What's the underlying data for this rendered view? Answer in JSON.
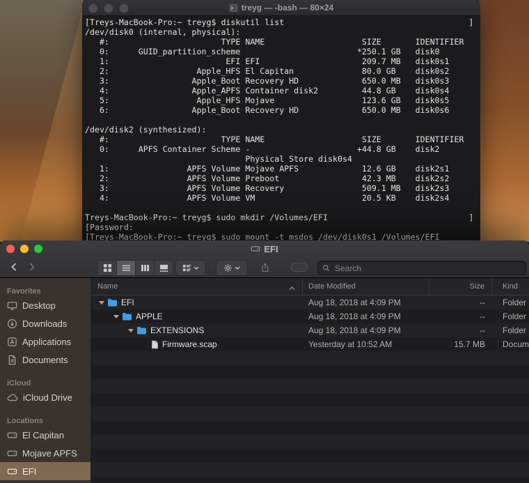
{
  "terminal": {
    "title": "treyg — -bash — 80×24",
    "lines": [
      "[Treys-MacBook-Pro:~ treyg$ diskutil list                                      ]",
      "/dev/disk0 (internal, physical):",
      "   #:                       TYPE NAME                    SIZE       IDENTIFIER",
      "   0:      GUID_partition_scheme                        *250.1 GB   disk0",
      "   1:                        EFI EFI                     209.7 MB   disk0s1",
      "   2:                  Apple_HFS El Capitan              80.0 GB    disk0s2",
      "   3:                 Apple_Boot Recovery HD             650.0 MB   disk0s3",
      "   4:                 Apple_APFS Container disk2         44.8 GB    disk0s4",
      "   5:                  Apple_HFS Mojave                  123.6 GB   disk0s5",
      "   6:                 Apple_Boot Recovery HD             650.0 MB   disk0s6",
      "",
      "/dev/disk2 (synthesized):",
      "   #:                       TYPE NAME                    SIZE       IDENTIFIER",
      "   0:      APFS Container Scheme -                      +44.8 GB    disk2",
      "                                 Physical Store disk0s4",
      "   1:                APFS Volume Mojave APFS             12.6 GB    disk2s1",
      "   2:                APFS Volume Preboot                 42.3 MB    disk2s2",
      "   3:                APFS Volume Recovery                509.1 MB   disk2s3",
      "   4:                APFS Volume VM                      20.5 KB    disk2s4",
      "",
      "Treys-MacBook-Pro:~ treyg$ sudo mkdir /Volumes/EFI                             ]",
      "[Password:",
      "[Treys-MacBook-Pro:~ treyg$ sudo mount -t msdos /dev/disk0s1 /Volumes/EFI"
    ]
  },
  "finder": {
    "title": "EFI",
    "toolbar": {
      "search_placeholder": "Search",
      "view_modes": [
        "icon-view",
        "list-view",
        "column-view",
        "gallery-view"
      ],
      "selected_view": "list-view"
    },
    "sidebar": {
      "sections": [
        {
          "label": "Favorites",
          "items": [
            {
              "label": "Desktop",
              "icon": "desktop-icon"
            },
            {
              "label": "Downloads",
              "icon": "downloads-icon"
            },
            {
              "label": "Applications",
              "icon": "applications-icon"
            },
            {
              "label": "Documents",
              "icon": "documents-icon"
            }
          ]
        },
        {
          "label": "iCloud",
          "items": [
            {
              "label": "iCloud Drive",
              "icon": "cloud-icon"
            }
          ]
        },
        {
          "label": "Locations",
          "items": [
            {
              "label": "El Capitan",
              "icon": "disk-icon"
            },
            {
              "label": "Mojave APFS",
              "icon": "disk-icon"
            },
            {
              "label": "EFI",
              "icon": "disk-icon",
              "selected": true
            }
          ]
        }
      ]
    },
    "list": {
      "columns": [
        "Name",
        "Date Modified",
        "Size",
        "Kind"
      ],
      "sort_column": "Name",
      "sort_direction": "ascending",
      "rows": [
        {
          "name": "EFI",
          "date": "Aug 18, 2018 at 4:09 PM",
          "size": "--",
          "kind": "Folder",
          "icon": "folder-icon",
          "indent": 0,
          "expanded": true
        },
        {
          "name": "APPLE",
          "date": "Aug 18, 2018 at 4:09 PM",
          "size": "--",
          "kind": "Folder",
          "icon": "folder-icon",
          "indent": 1,
          "expanded": true
        },
        {
          "name": "EXTENSIONS",
          "date": "Aug 18, 2018 at 4:09 PM",
          "size": "--",
          "kind": "Folder",
          "icon": "folder-icon",
          "indent": 2,
          "expanded": true
        },
        {
          "name": "Firmware.scap",
          "date": "Yesterday at 10:52 AM",
          "size": "15.7 MB",
          "kind": "Document",
          "icon": "document-icon",
          "indent": 3,
          "expanded": false
        }
      ]
    }
  },
  "colors": {
    "folder_blue": "#3f9fe8",
    "sidebar_selection": "#7e6952",
    "terminal_background": "#1b1b1d",
    "traffic_red": "#ff5e57",
    "traffic_yellow": "#febb2e",
    "traffic_green": "#2bc840"
  }
}
